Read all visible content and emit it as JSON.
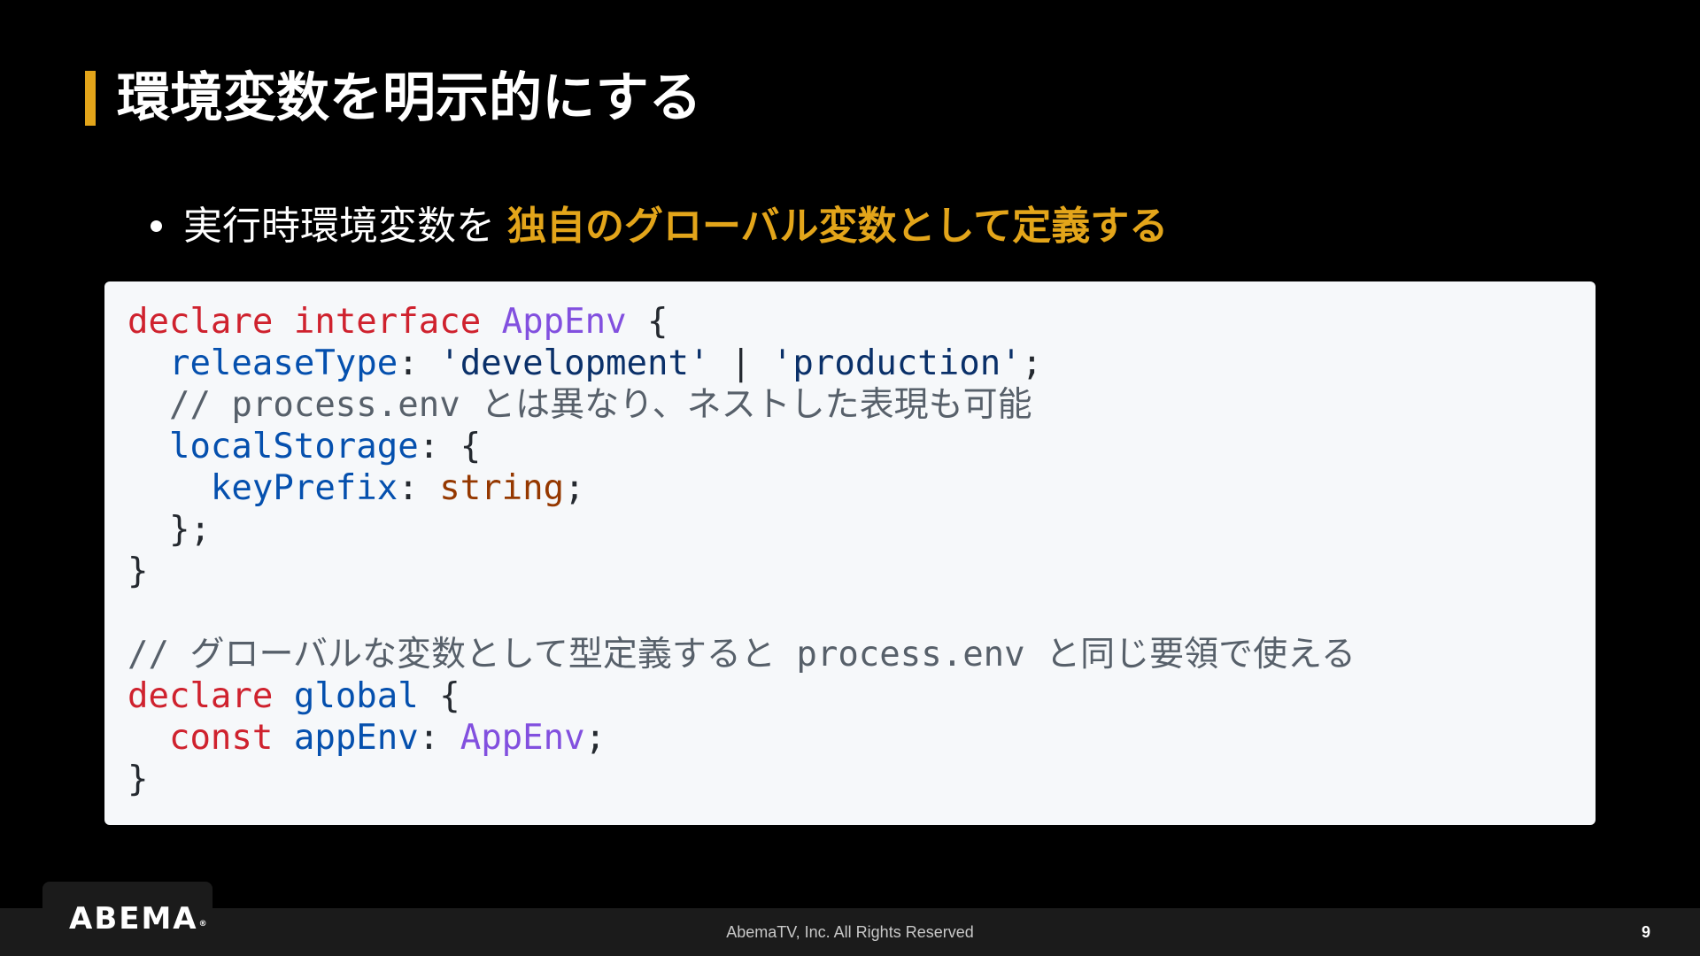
{
  "slide": {
    "title": "環境変数を明示的にする",
    "bullet": {
      "plain": "実行時環境変数を ",
      "emphasis": "独自のグローバル変数として定義する"
    },
    "page_number": "9",
    "accent_color": "#e3a51a",
    "background_color": "#000000"
  },
  "code": {
    "l1": {
      "kw": "declare",
      "kw2": "interface",
      "type": "AppEnv",
      "brace": "{"
    },
    "l2": {
      "prop": "releaseType",
      "str1": "'development'",
      "pipe": "|",
      "str2": "'production'"
    },
    "l3": {
      "comment": "// process.env とは異なり、ネストした表現も可能"
    },
    "l4": {
      "prop": "localStorage",
      "brace": "{"
    },
    "l5": {
      "prop": "keyPrefix",
      "type": "string"
    },
    "l6": {
      "close": "};"
    },
    "l7": {
      "close": "}"
    },
    "l9": {
      "comment": "// グローバルな変数として型定義すると process.env と同じ要領で使える"
    },
    "l10": {
      "kw": "declare",
      "name": "global",
      "brace": "{"
    },
    "l11": {
      "kw": "const",
      "name": "appEnv",
      "type": "AppEnv"
    },
    "l12": {
      "close": "}"
    }
  },
  "footer": {
    "logo": "ABEMA",
    "logo_mark": "®",
    "copyright": "AbemaTV, Inc. All Rights Reserved"
  }
}
